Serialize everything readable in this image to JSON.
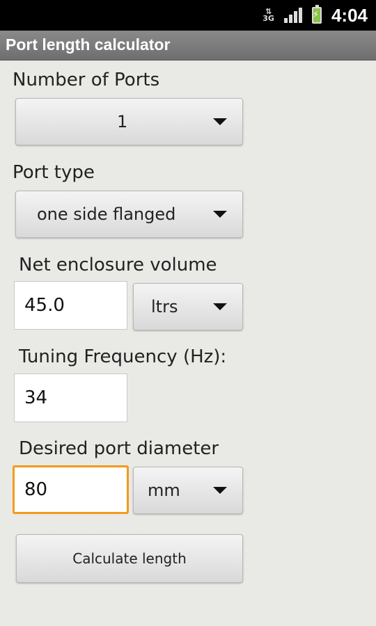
{
  "status_bar": {
    "network": "3G",
    "time": "4:04"
  },
  "app": {
    "title": "Port length calculator"
  },
  "form": {
    "number_of_ports": {
      "label": "Number of Ports",
      "value": "1"
    },
    "port_type": {
      "label": "Port type",
      "value": "one side flanged"
    },
    "net_volume": {
      "label": "Net enclosure volume",
      "value": "45.0",
      "unit": "ltrs"
    },
    "tuning_frequency": {
      "label": "Tuning Frequency (Hz):",
      "value": "34"
    },
    "port_diameter": {
      "label": "Desired port diameter",
      "value": "80",
      "unit": "mm"
    },
    "calculate_label": "Calculate length"
  },
  "colors": {
    "focus_border": "#f39a1c",
    "title_bar": "#7a7a7a",
    "background": "#e9e9e6"
  }
}
